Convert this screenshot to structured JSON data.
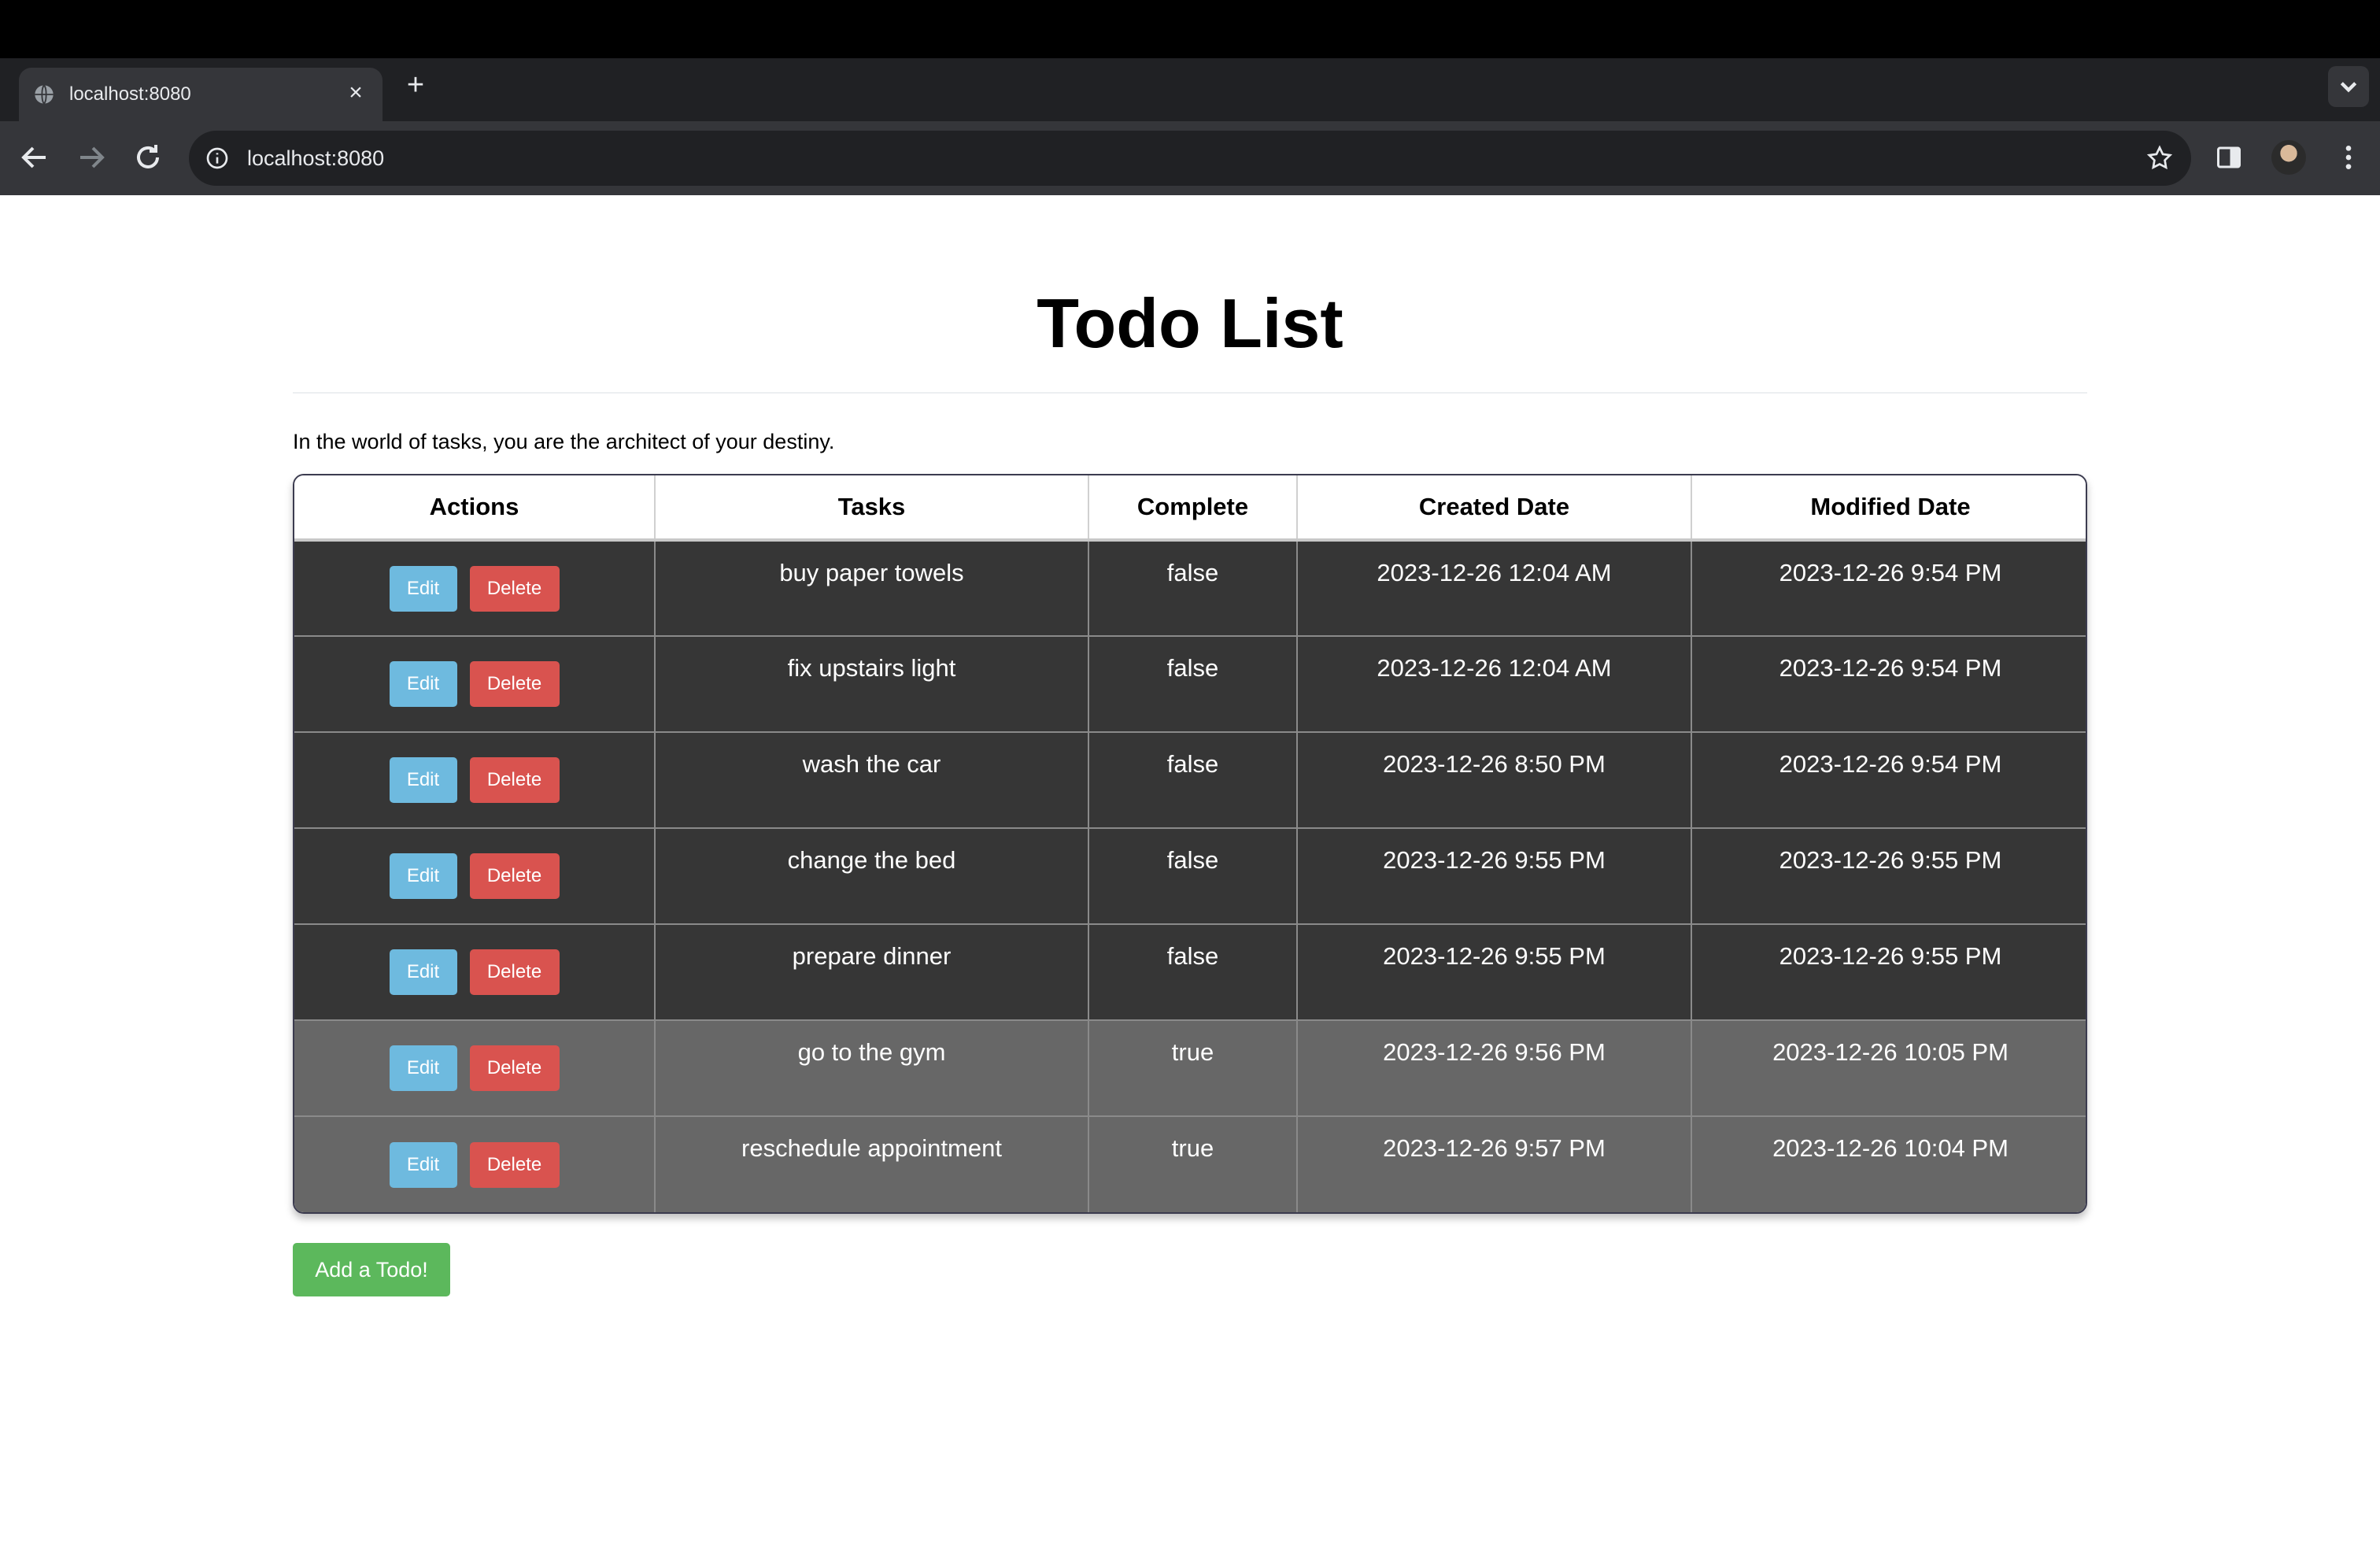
{
  "browser": {
    "tab_title": "localhost:8080",
    "new_tab_symbol": "+",
    "close_symbol": "×",
    "url": "localhost:8080"
  },
  "page": {
    "title": "Todo List",
    "tagline": "In the world of tasks, you are the architect of your destiny.",
    "add_button": "Add a Todo!"
  },
  "table": {
    "headers": [
      "Actions",
      "Tasks",
      "Complete",
      "Created Date",
      "Modified Date"
    ],
    "edit_label": "Edit",
    "delete_label": "Delete",
    "rows": [
      {
        "task": "buy paper towels",
        "complete": "false",
        "created": "2023-12-26 12:04 AM",
        "modified": "2023-12-26 9:54 PM"
      },
      {
        "task": "fix upstairs light",
        "complete": "false",
        "created": "2023-12-26 12:04 AM",
        "modified": "2023-12-26 9:54 PM"
      },
      {
        "task": "wash the car",
        "complete": "false",
        "created": "2023-12-26 8:50 PM",
        "modified": "2023-12-26 9:54 PM"
      },
      {
        "task": "change the bed",
        "complete": "false",
        "created": "2023-12-26 9:55 PM",
        "modified": "2023-12-26 9:55 PM"
      },
      {
        "task": "prepare dinner",
        "complete": "false",
        "created": "2023-12-26 9:55 PM",
        "modified": "2023-12-26 9:55 PM"
      },
      {
        "task": "go to the gym",
        "complete": "true",
        "created": "2023-12-26 9:56 PM",
        "modified": "2023-12-26 10:05 PM"
      },
      {
        "task": "reschedule appointment",
        "complete": "true",
        "created": "2023-12-26 9:57 PM",
        "modified": "2023-12-26 10:04 PM"
      }
    ]
  },
  "colors": {
    "edit_button": "#6ebadf",
    "delete_button": "#d9534f",
    "add_button": "#5cb85c",
    "incomplete_row": "#363636",
    "complete_row": "#676767"
  },
  "icons": [
    "globe-icon",
    "close-icon",
    "plus-icon",
    "chevron-down-icon",
    "back-arrow-icon",
    "forward-arrow-icon",
    "reload-icon",
    "info-icon",
    "star-icon",
    "side-panel-icon",
    "avatar",
    "kebab-menu-icon"
  ]
}
